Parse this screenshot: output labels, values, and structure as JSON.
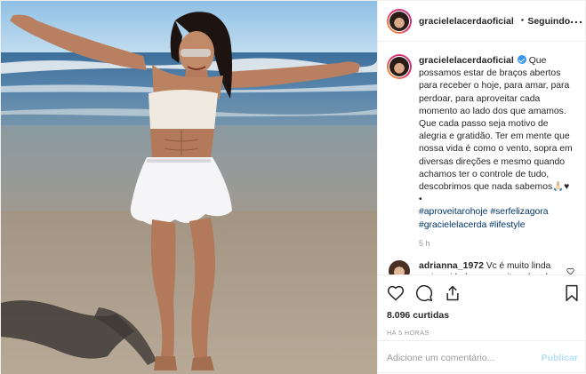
{
  "header": {
    "username": "gracielelacerdaoficial",
    "separator": "•",
    "follow_label": "Seguindo",
    "more_label": "..."
  },
  "caption": {
    "username": "gracielelacerdaoficial",
    "text": "Que possamos estar de braços abertos para receber o hoje, para amar, para perdoar, para aproveitar cada momento ao lado dos que amamos. Que cada passo seja motivo de alegria e gratidão. Ter em mente que nossa vida é como o vento, sopra em diversas direções e mesmo quando achamos ter o controle de tudo, descobrimos que nada sabemos",
    "emoji": "🙏🏻♥",
    "bullet": "•",
    "hashtags": [
      "#aproveitarohoje",
      "#serfelizagora",
      "#gracielelacerda",
      "#lifestyle"
    ],
    "time": "5 h"
  },
  "comments": [
    {
      "username": "adrianna_1972",
      "text": "Vc é muito linda mais cuidado com muito músculo pq te faz ficar parecida com"
    }
  ],
  "actions": {
    "like_icon": "heart-icon",
    "comment_icon": "comment-icon",
    "share_icon": "share-icon",
    "save_icon": "bookmark-icon"
  },
  "likes": "8.096 curtidas",
  "date": "HÁ 5 HORAS",
  "add_comment": {
    "placeholder": "Adicione um comentário...",
    "publish_label": "Publicar"
  },
  "colors": {
    "link": "#003569",
    "verified": "#3897f0",
    "publish_disabled": "#b2dffc",
    "muted": "#999999"
  }
}
